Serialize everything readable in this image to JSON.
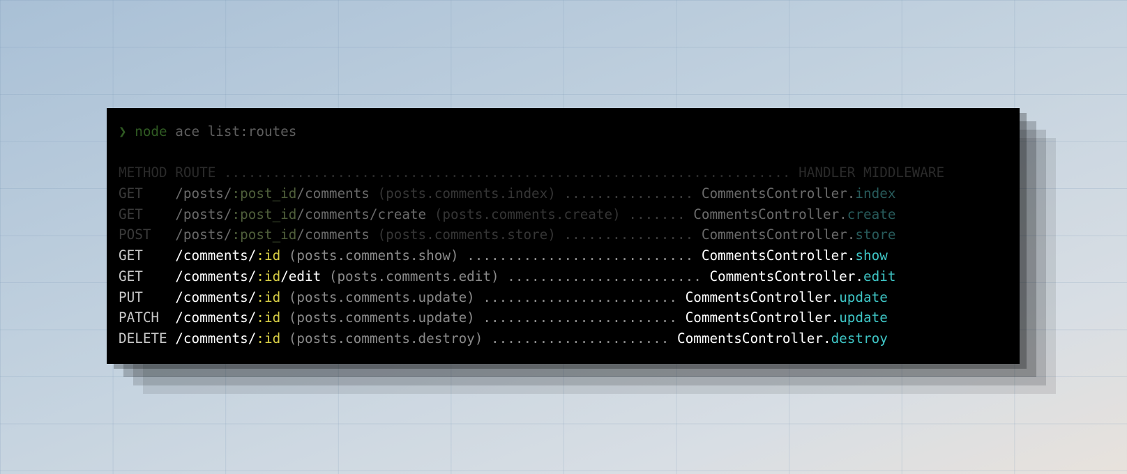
{
  "terminal": {
    "prompt_symbol": "❯",
    "command_bin": "node",
    "command_args": "ace list:routes",
    "header": {
      "method": "METHOD",
      "route": "ROUTE",
      "dots": "......................................................................",
      "handler": "HANDLER",
      "middleware": "MIDDLEWARE"
    },
    "routes": [
      {
        "method": "GET   ",
        "prefix": "/posts/",
        "param": ":post_id",
        "suffix": "/comments",
        "name": "(posts.comments.index)",
        "dots": "................",
        "controller": "CommentsController.",
        "action": "index",
        "dimmed": true
      },
      {
        "method": "GET   ",
        "prefix": "/posts/",
        "param": ":post_id",
        "suffix": "/comments/create",
        "name": "(posts.comments.create)",
        "dots": ".......",
        "controller": "CommentsController.",
        "action": "create",
        "dimmed": true
      },
      {
        "method": "POST  ",
        "prefix": "/posts/",
        "param": ":post_id",
        "suffix": "/comments",
        "name": "(posts.comments.store)",
        "dots": "................",
        "controller": "CommentsController.",
        "action": "store",
        "dimmed": true
      },
      {
        "method": "GET   ",
        "prefix": "/comments/",
        "param": ":id",
        "suffix": "",
        "name": "(posts.comments.show)",
        "dots": "............................",
        "controller": "CommentsController.",
        "action": "show",
        "dimmed": false
      },
      {
        "method": "GET   ",
        "prefix": "/comments/",
        "param": ":id",
        "suffix": "/edit",
        "name": "(posts.comments.edit)",
        "dots": "........................",
        "controller": "CommentsController.",
        "action": "edit",
        "dimmed": false
      },
      {
        "method": "PUT   ",
        "prefix": "/comments/",
        "param": ":id",
        "suffix": "",
        "name": "(posts.comments.update)",
        "dots": "........................",
        "controller": "CommentsController.",
        "action": "update",
        "dimmed": false
      },
      {
        "method": "PATCH ",
        "prefix": "/comments/",
        "param": ":id",
        "suffix": "",
        "name": "(posts.comments.update)",
        "dots": "........................",
        "controller": "CommentsController.",
        "action": "update",
        "dimmed": false
      },
      {
        "method": "DELETE",
        "prefix": "/comments/",
        "param": ":id",
        "suffix": "",
        "name": "(posts.comments.destroy)",
        "dots": "......................",
        "controller": "CommentsController.",
        "action": "destroy",
        "dimmed": false
      }
    ]
  }
}
